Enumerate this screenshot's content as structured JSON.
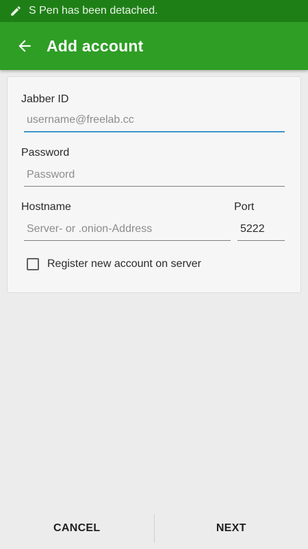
{
  "status_bar": {
    "notification": "S Pen has been detached.",
    "icon": "pen-icon"
  },
  "app_bar": {
    "title": "Add account",
    "back_icon": "arrow-back-icon"
  },
  "form": {
    "jabber_id": {
      "label": "Jabber ID",
      "placeholder": "username@freelab.cc",
      "value": ""
    },
    "password": {
      "label": "Password",
      "placeholder": "Password",
      "value": ""
    },
    "hostname": {
      "label": "Hostname",
      "placeholder": "Server- or .onion-Address",
      "value": ""
    },
    "port": {
      "label": "Port",
      "value": "5222"
    },
    "register": {
      "label": "Register new account on server",
      "checked": false
    }
  },
  "actions": {
    "cancel": "CANCEL",
    "next": "NEXT"
  },
  "colors": {
    "status_bar": "#1f7f17",
    "app_bar": "#2e9e25",
    "accent_underline": "#3f95c9",
    "background": "#ececec"
  }
}
